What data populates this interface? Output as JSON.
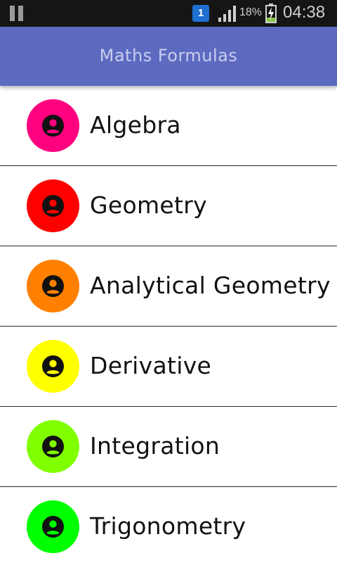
{
  "status_bar": {
    "notification_badge": "1",
    "battery_percent": "18%",
    "time": "04:38",
    "icons": [
      "pause-icon",
      "notification-icon",
      "signal-icon",
      "battery-charging-icon"
    ]
  },
  "app_bar": {
    "title": "Maths Formulas",
    "color": "#5c6bc0"
  },
  "topics": [
    {
      "label": "Algebra",
      "color": "#ff0080",
      "icon": "account-circle-icon"
    },
    {
      "label": "Geometry",
      "color": "#ff0000",
      "icon": "account-circle-icon"
    },
    {
      "label": "Analytical Geometry",
      "color": "#ff8000",
      "icon": "account-circle-icon"
    },
    {
      "label": "Derivative",
      "color": "#ffff00",
      "icon": "account-circle-icon"
    },
    {
      "label": "Integration",
      "color": "#80ff00",
      "icon": "account-circle-icon"
    },
    {
      "label": "Trigonometry",
      "color": "#00ff00",
      "icon": "account-circle-icon"
    }
  ]
}
